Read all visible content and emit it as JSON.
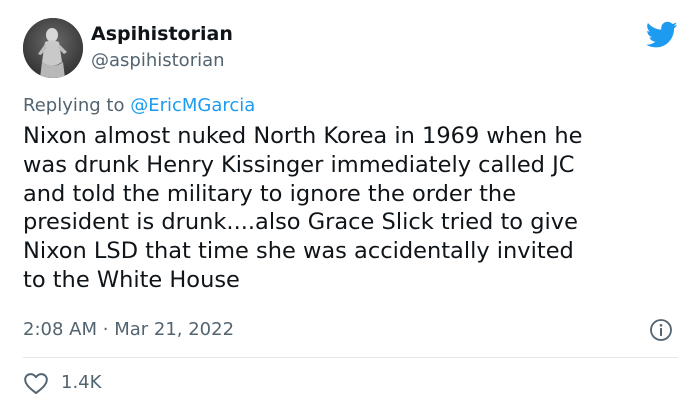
{
  "author": {
    "display_name": "Aspihistorian",
    "handle": "@aspihistorian",
    "avatar": "statue-avatar"
  },
  "platform_icon": "twitter-bird-icon",
  "reply": {
    "prefix": "Replying to",
    "mention": "@EricMGarcia"
  },
  "tweet": {
    "lines": [
      "Nixon almost nuked North Korea in 1969 when he",
      "was drunk Henry Kissinger immediately called JC",
      "and told the military to ignore the order the",
      "president is drunk....also Grace Slick tried to give",
      "Nixon LSD that time she was accidentally invited",
      "to the White House"
    ]
  },
  "meta": {
    "time": "2:08 AM",
    "separator": "·",
    "date": "Mar 21, 2022"
  },
  "engagement": {
    "likes": "1.4K"
  },
  "colors": {
    "accent": "#1d9bf0",
    "secondary_text": "#536471",
    "primary_text": "#0f1419"
  }
}
